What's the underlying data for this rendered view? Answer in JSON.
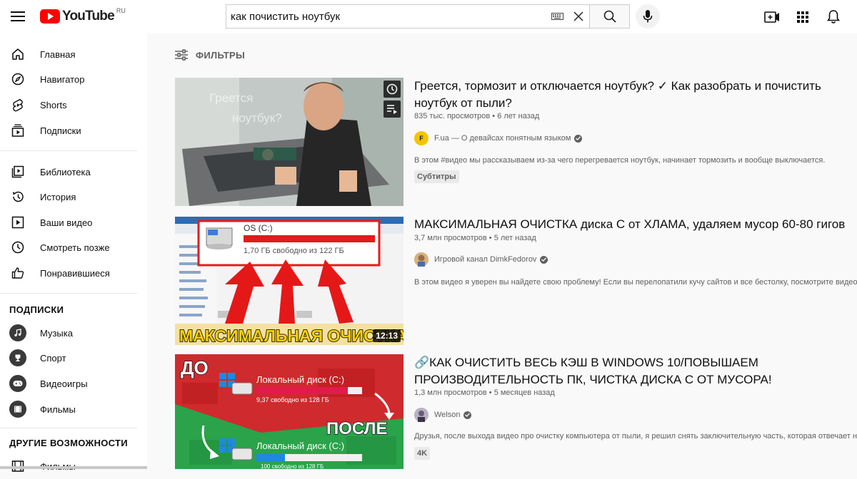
{
  "header": {
    "logo_text": "YouTube",
    "logo_region": "RU",
    "search_value": "как почистить ноутбук"
  },
  "sidebar": {
    "main": [
      {
        "label": "Главная",
        "icon": "home-icon"
      },
      {
        "label": "Навигатор",
        "icon": "compass-icon"
      },
      {
        "label": "Shorts",
        "icon": "shorts-icon"
      },
      {
        "label": "Подписки",
        "icon": "subscriptions-icon"
      }
    ],
    "library": [
      {
        "label": "Библиотека",
        "icon": "library-icon"
      },
      {
        "label": "История",
        "icon": "history-icon"
      },
      {
        "label": "Ваши видео",
        "icon": "your-videos-icon"
      },
      {
        "label": "Смотреть позже",
        "icon": "watch-later-icon"
      },
      {
        "label": "Понравившиеся",
        "icon": "thumbs-up-icon"
      }
    ],
    "subscriptions_heading": "ПОДПИСКИ",
    "subscriptions": [
      {
        "label": "Музыка",
        "icon": "music-icon"
      },
      {
        "label": "Спорт",
        "icon": "sport-icon"
      },
      {
        "label": "Видеоигры",
        "icon": "gaming-icon"
      },
      {
        "label": "Фильмы",
        "icon": "movies-icon"
      }
    ],
    "more_heading": "ДРУГИЕ ВОЗМОЖНОСТИ",
    "more": [
      {
        "label": "Фильмы",
        "icon": "movies-icon"
      }
    ]
  },
  "filters_label": "ФИЛЬТРЫ",
  "videos": [
    {
      "title_line1": "Греется, тормозит и отключается ноутбук? ✓ Как разобрать и почистить",
      "title_line2": "ноутбук от пыли?",
      "views": "835 тыс. просмотров",
      "age": "6 лет назад",
      "channel": "F.ua — О девайсах понятным языком",
      "description": "В этом #видео мы рассказываем из-за чего перегревается ноутбук, начинает тормозить и вообще выключается.",
      "badge": "Субтитры",
      "thumb_text_1": "Греется",
      "thumb_text_2": "ноутбук?"
    },
    {
      "title_line1": "МАКСИМАЛЬНАЯ ОЧИСТКА диска С от ХЛАМА, удаляем мусор 60-80 гигов",
      "views": "3,7 млн просмотров",
      "age": "5 лет назад",
      "channel": "Игровой канал DimkFedorov",
      "description": "В этом видео я уверен вы найдете свою проблему! Если вы перелопатили кучу сайтов и все бестолку, посмотрите видео и",
      "duration": "12:13",
      "thumb_drive": "OS (C:)",
      "thumb_free": "1,70 ГБ свободно из 122 ГБ",
      "thumb_banner": "МАКСИМАЛЬНАЯ ОЧИСТКА"
    },
    {
      "title_line1": "🔗КАК ОЧИСТИТЬ ВЕСЬ КЭШ В WINDOWS 10/ПОВЫШАЕМ",
      "title_line2": "ПРОИЗВОДИТЕЛЬНОСТЬ ПК, ЧИСТКА ДИСКА С ОТ МУСОРА!",
      "views": "1,3 млн просмотров",
      "age": "5 месяцев назад",
      "channel": "Welson",
      "description": "Друзья, после выхода видео про очистку компьютера от пыли, я решил снять заключительную часть, которая отвечает на",
      "badge": "4K",
      "thumb_before": "ДО",
      "thumb_after": "ПОСЛЕ",
      "thumb_drive_1": "Локальный диск (C:)",
      "thumb_free_1": "9,37 свободно из 128 ГБ",
      "thumb_drive_2": "Локальный диск (C:)",
      "thumb_free_2": "100 свободно из 128 ГБ"
    }
  ],
  "colors": {
    "youtube_red": "#ff0000",
    "text_primary": "#0f0f0f",
    "text_secondary": "#606060"
  }
}
